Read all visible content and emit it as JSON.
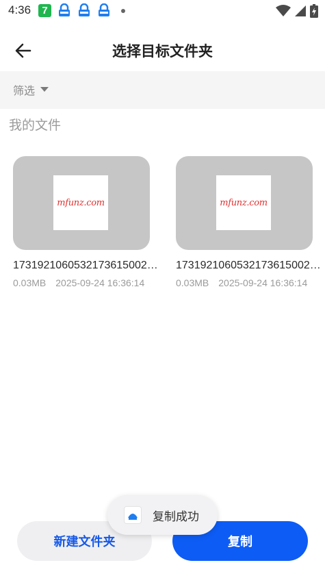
{
  "status_bar": {
    "time": "4:36",
    "app_icon_text": "7"
  },
  "header": {
    "title": "选择目标文件夹"
  },
  "filter": {
    "label": "筛选"
  },
  "section": {
    "title": "我的文件"
  },
  "files": [
    {
      "thumbnail_text": "mfunz.com",
      "name": "1731921060532173615002…",
      "size": "0.03MB",
      "date": "2025-09-24 16:36:14"
    },
    {
      "thumbnail_text": "mfunz.com",
      "name": "1731921060532173615002…",
      "size": "0.03MB",
      "date": "2025-09-24 16:36:14"
    }
  ],
  "buttons": {
    "new_folder": "新建文件夹",
    "copy": "复制"
  },
  "toast": {
    "message": "复制成功"
  },
  "colors": {
    "primary": "#0d5cf5",
    "secondary_text": "#1658e6",
    "thumbnail_bg": "#c6c6c6",
    "filter_bg": "#f5f5f5"
  }
}
